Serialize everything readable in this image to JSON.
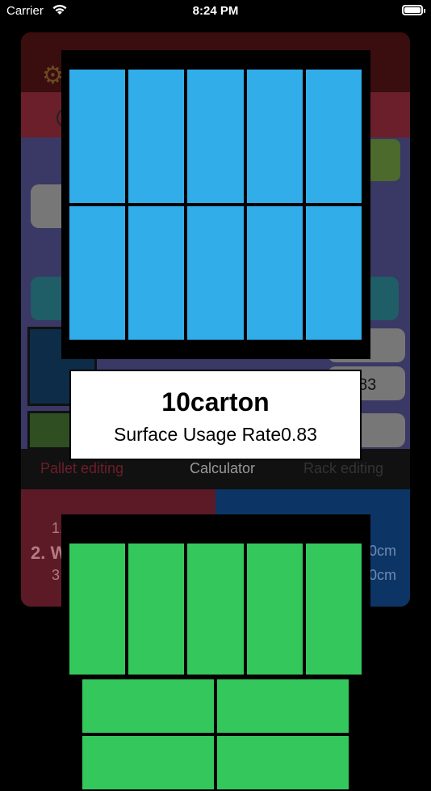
{
  "status_bar": {
    "carrier": "Carrier",
    "time": "8:24 PM",
    "wifi_icon": "wifi-icon",
    "battery_icon": "battery-icon"
  },
  "background_app": {
    "gear_icon": "gear-icon",
    "value_text": "83",
    "tabs": [
      {
        "label": "Pallet editing"
      },
      {
        "label": "Calculator"
      },
      {
        "label": "Rack editing"
      }
    ],
    "left_list": [
      "1.",
      "2. W",
      "3"
    ],
    "right_list": [
      "0cm",
      "0cm"
    ],
    "colors": {
      "header": "#3a0d0f",
      "main_panel": "#3a3864",
      "tab_active": "#6d1e2a"
    }
  },
  "result": {
    "count": "10carton",
    "surface_usage": "Surface Usage Rate0.83"
  },
  "top_pallet": {
    "box_color": "#31adea",
    "rows": 2,
    "cols": 5
  },
  "bottom_pallet": {
    "box_color": "#34c85c",
    "top_rows": 1,
    "top_cols": 5,
    "bottom_rows": 2,
    "bottom_cols": 2
  }
}
